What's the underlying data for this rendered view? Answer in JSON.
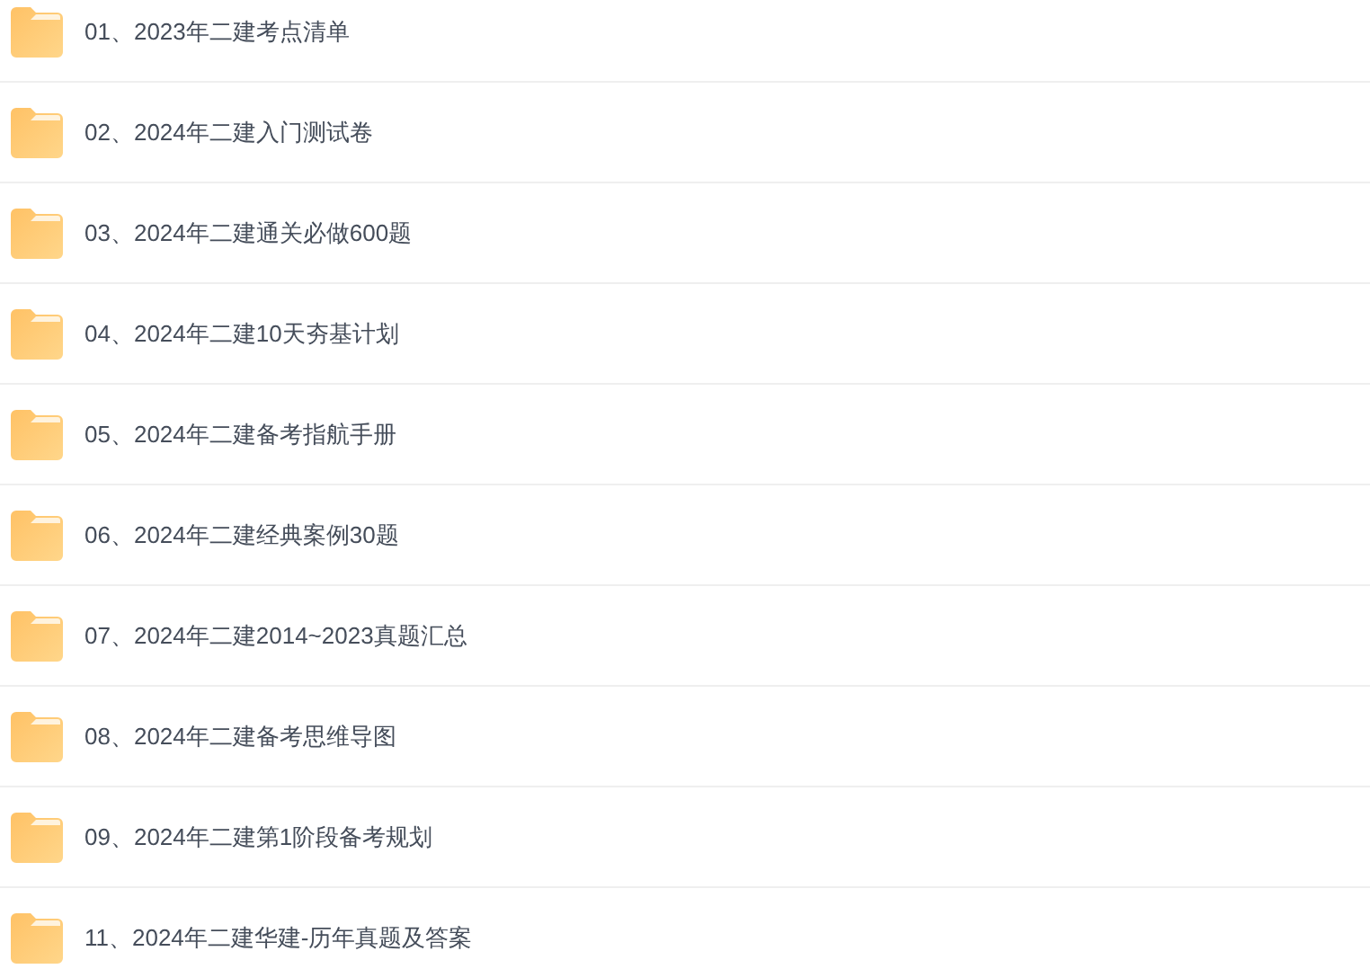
{
  "folders": [
    {
      "name": "01、2023年二建考点清单"
    },
    {
      "name": "02、2024年二建入门测试卷"
    },
    {
      "name": "03、2024年二建通关必做600题"
    },
    {
      "name": "04、2024年二建10天夯基计划"
    },
    {
      "name": "05、2024年二建备考指航手册"
    },
    {
      "name": "06、2024年二建经典案例30题"
    },
    {
      "name": "07、2024年二建2014~2023真题汇总"
    },
    {
      "name": "08、2024年二建备考思维导图"
    },
    {
      "name": "09、2024年二建第1阶段备考规划"
    },
    {
      "name": "11、2024年二建华建-历年真题及答案"
    }
  ]
}
